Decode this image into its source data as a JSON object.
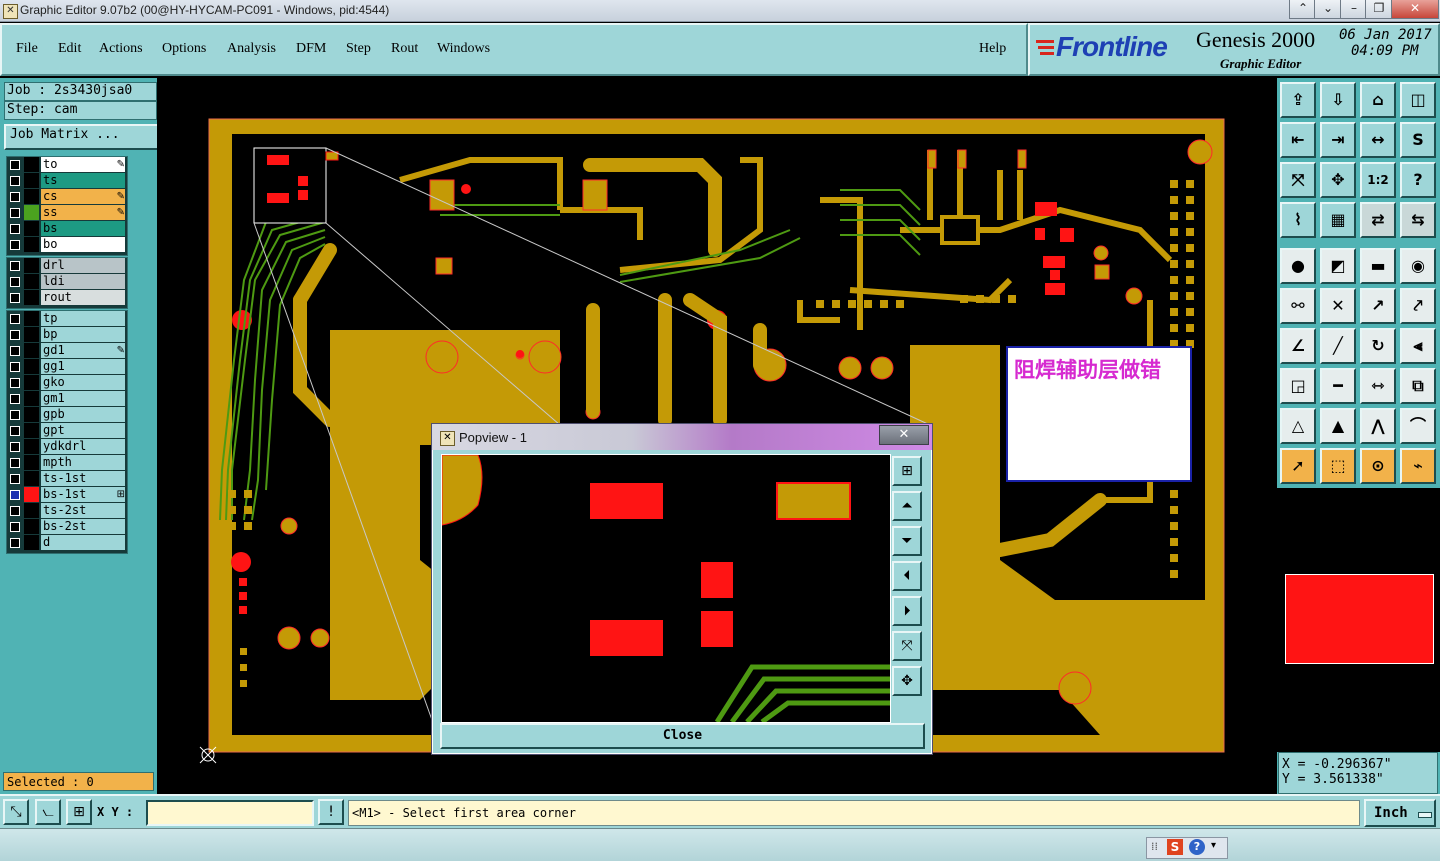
{
  "window": {
    "title": "Graphic Editor 9.07b2 (00@HY-HYCAM-PC091 - Windows, pid:4544)",
    "minimize": "–",
    "maximize": "❐",
    "close": "✕",
    "extra_controls": [
      "⌃",
      "⌄"
    ]
  },
  "menu": {
    "items": [
      "File",
      "Edit",
      "Actions",
      "Options",
      "Analysis",
      "DFM",
      "Step",
      "Rout",
      "Windows"
    ],
    "help": "Help"
  },
  "brand": {
    "logo": "Frontline",
    "product": "Genesis 2000",
    "subtitle": "Graphic Editor",
    "date": "06 Jan 2017",
    "time": "04:09 PM"
  },
  "job": {
    "job_label": "Job : 2s3430jsa0",
    "step_label": "Step: cam",
    "matrix_button": "Job Matrix ..."
  },
  "layers": {
    "group1": [
      {
        "name": "to",
        "color": "#ffffff",
        "flag": "✎"
      },
      {
        "name": "ts",
        "color": "#1d9a83",
        "flag": ""
      },
      {
        "name": "cs",
        "color": "#f2b24a",
        "flag": "✎"
      },
      {
        "name": "ss",
        "color": "#f2b24a",
        "flag": "✎"
      },
      {
        "name": "bs",
        "color": "#1d9a83",
        "flag": ""
      },
      {
        "name": "bo",
        "color": "#ffffff",
        "flag": ""
      }
    ],
    "group2": [
      {
        "name": "drl",
        "color": "#b8c4c8"
      },
      {
        "name": "ldi",
        "color": "#b8c4c8"
      },
      {
        "name": "rout",
        "color": "#d8dede"
      }
    ],
    "group3": [
      {
        "name": "tp"
      },
      {
        "name": "bp"
      },
      {
        "name": "gd1",
        "flag": "✎"
      },
      {
        "name": "gg1"
      },
      {
        "name": "gko"
      },
      {
        "name": "gm1"
      },
      {
        "name": "gpb"
      },
      {
        "name": "gpt"
      },
      {
        "name": "ydkdrl"
      },
      {
        "name": "mpth"
      },
      {
        "name": "ts-1st"
      },
      {
        "name": "bs-1st",
        "flag": "⊞"
      },
      {
        "name": "ts-2st"
      },
      {
        "name": "bs-2st"
      },
      {
        "name": "d"
      }
    ]
  },
  "selected": "Selected : 0",
  "annotation": "阻焊辅助层做错",
  "popview": {
    "title": "Popview - 1",
    "close_x": "✕",
    "close_button": "Close"
  },
  "coords": {
    "x": "X = -0.296367\"",
    "y": "Y = 3.561338\""
  },
  "statusbar": {
    "xy_label": "X Y :",
    "message": "<M1> - Select first area corner",
    "units": "Inch"
  },
  "colors": {
    "panel": "#9ed6d8",
    "panel_dark": "#50b3b4",
    "copper": "#c49a06",
    "trace_green": "#4e9a12",
    "pad_red": "#ff1414"
  }
}
